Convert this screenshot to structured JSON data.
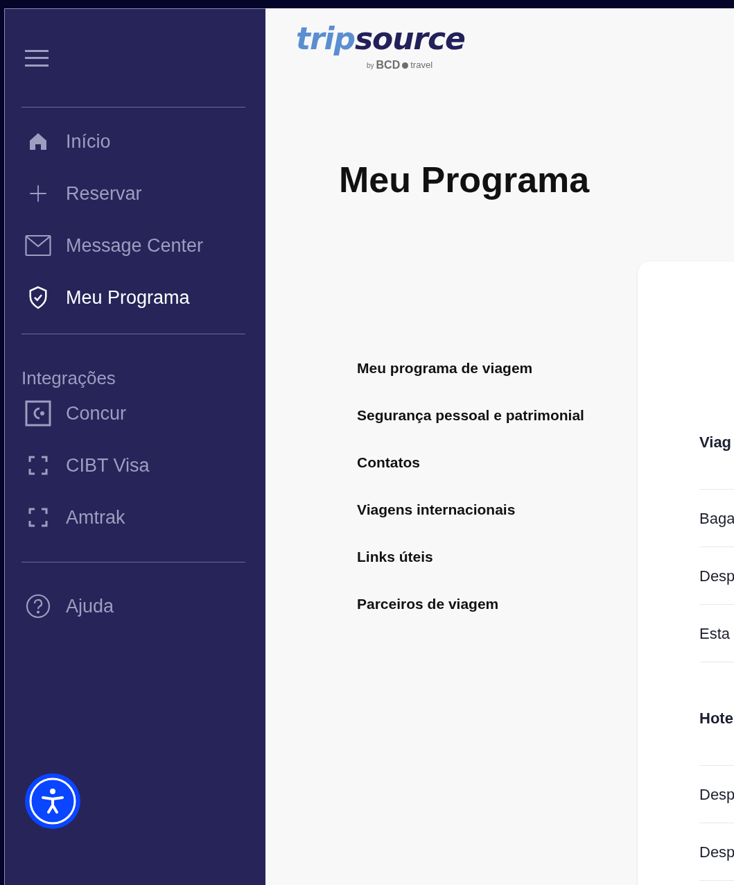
{
  "sidebar": {
    "nav_items": [
      {
        "kind": "home",
        "label": "Início",
        "selected": false
      },
      {
        "kind": "plus",
        "label": "Reservar",
        "selected": false
      },
      {
        "kind": "mail",
        "label": "Message Center",
        "selected": false
      },
      {
        "kind": "shield",
        "label": "Meu Programa",
        "selected": true
      }
    ],
    "integrations": {
      "heading": "Integrações",
      "items": [
        {
          "kind": "concur",
          "label": "Concur"
        },
        {
          "kind": "frame",
          "label": "CIBT Visa"
        },
        {
          "kind": "frame",
          "label": "Amtrak"
        }
      ]
    },
    "help": {
      "label": "Ajuda"
    }
  },
  "logo": {
    "part_1": "trip",
    "part_2": "source",
    "byline_prefix": "by",
    "byline_brand": "BCD",
    "byline_suffix": "travel"
  },
  "page_title": "Meu Programa",
  "section_nav": [
    "Meu programa de viagem",
    "Segurança pessoal e patrimonial",
    "Contatos",
    "Viagens internacionais",
    "Links úteis",
    "Parceiros de viagem"
  ],
  "card": {
    "groups": [
      {
        "heading": "Viag",
        "rows": [
          "Baga",
          "Desp",
          "Esta"
        ]
      },
      {
        "heading": "Hote",
        "rows": [
          "Desp",
          "Desp"
        ]
      }
    ]
  }
}
